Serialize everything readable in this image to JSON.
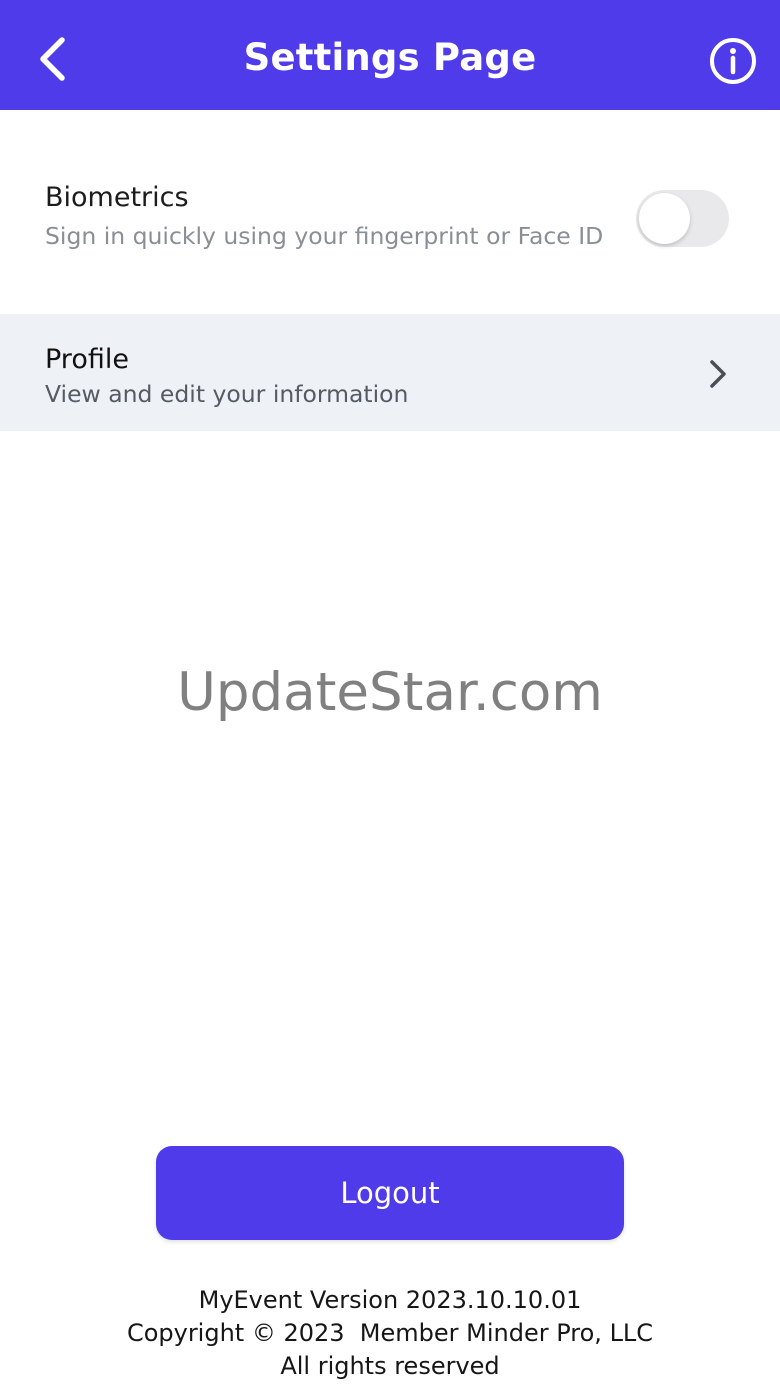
{
  "header": {
    "title": "Settings Page",
    "back_icon": "chevron-left-icon",
    "info_icon": "info-circle-icon",
    "background_color": "#4f3bea"
  },
  "settings": {
    "biometrics": {
      "title": "Biometrics",
      "subtitle": "Sign in quickly using your fingerprint or Face ID",
      "enabled": false
    },
    "profile": {
      "title": "Profile",
      "subtitle": "View and edit your information",
      "chevron_icon": "chevron-right-icon"
    }
  },
  "watermark": "UpdateStar.com",
  "actions": {
    "logout_label": "Logout"
  },
  "footer": {
    "version": "MyEvent Version 2023.10.10.01",
    "copyright": "Copyright © 2023  Member Minder Pro, LLC",
    "rights": "All rights reserved"
  }
}
